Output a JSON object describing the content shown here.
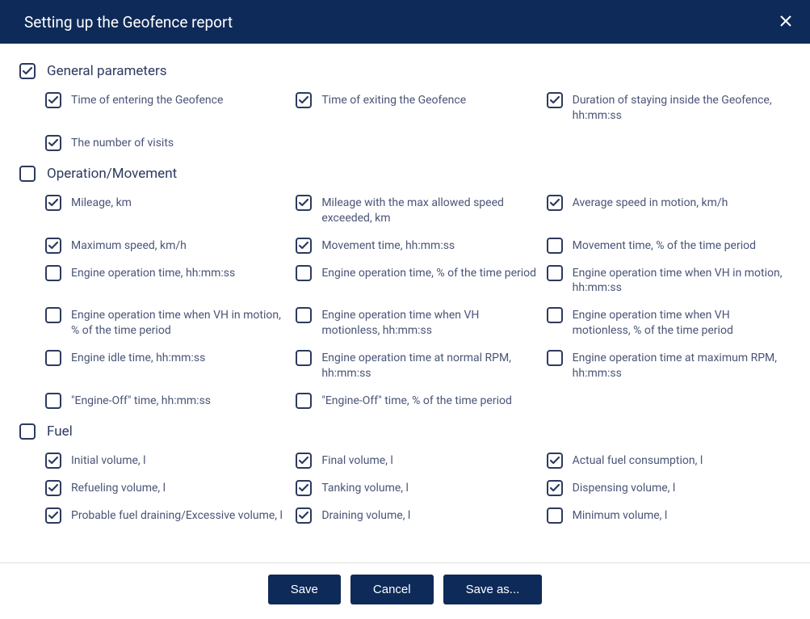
{
  "header": {
    "title": "Setting up the Geofence report"
  },
  "sections": [
    {
      "id": "general",
      "title": "General parameters",
      "checked": true,
      "items": [
        {
          "label": "Time of entering the Geofence",
          "checked": true
        },
        {
          "label": "Time of exiting the Geofence",
          "checked": true
        },
        {
          "label": "Duration of staying inside the Geofence, hh:mm:ss",
          "checked": true
        },
        {
          "label": "The number of visits",
          "checked": true
        }
      ]
    },
    {
      "id": "operation",
      "title": "Operation/Movement",
      "checked": false,
      "items": [
        {
          "label": "Mileage, km",
          "checked": true
        },
        {
          "label": "Mileage with the max allowed speed exceeded, km",
          "checked": true
        },
        {
          "label": "Average speed in motion, km/h",
          "checked": true
        },
        {
          "label": "Maximum speed, km/h",
          "checked": true
        },
        {
          "label": "Movement time, hh:mm:ss",
          "checked": true
        },
        {
          "label": "Movement time, % of the time period",
          "checked": false
        },
        {
          "label": "Engine operation time, hh:mm:ss",
          "checked": false
        },
        {
          "label": "Engine operation time, % of the time period",
          "checked": false
        },
        {
          "label": "Engine operation time when VH in motion, hh:mm:ss",
          "checked": false
        },
        {
          "label": "Engine operation time when VH in motion, % of the time period",
          "checked": false
        },
        {
          "label": "Engine operation time when VH motionless, hh:mm:ss",
          "checked": false
        },
        {
          "label": "Engine operation time when VH motionless, % of the time period",
          "checked": false
        },
        {
          "label": "Engine idle time, hh:mm:ss",
          "checked": false
        },
        {
          "label": "Engine operation time at normal RPM, hh:mm:ss",
          "checked": false
        },
        {
          "label": "Engine operation time at maximum RPM, hh:mm:ss",
          "checked": false
        },
        {
          "label": "\"Engine-Off\" time, hh:mm:ss",
          "checked": false
        },
        {
          "label": "\"Engine-Off\" time, % of the time period",
          "checked": false
        }
      ]
    },
    {
      "id": "fuel",
      "title": "Fuel",
      "checked": false,
      "items": [
        {
          "label": "Initial volume, l",
          "checked": true
        },
        {
          "label": "Final volume, l",
          "checked": true
        },
        {
          "label": "Actual fuel consumption, l",
          "checked": true
        },
        {
          "label": "Refueling volume, l",
          "checked": true
        },
        {
          "label": "Tanking volume, l",
          "checked": true
        },
        {
          "label": "Dispensing volume, l",
          "checked": true
        },
        {
          "label": "Probable fuel draining/Excessive volume, l",
          "checked": true
        },
        {
          "label": "Draining volume, l",
          "checked": true
        },
        {
          "label": "Minimum volume, l",
          "checked": false
        }
      ]
    }
  ],
  "footer": {
    "save": "Save",
    "cancel": "Cancel",
    "saveas": "Save as..."
  }
}
